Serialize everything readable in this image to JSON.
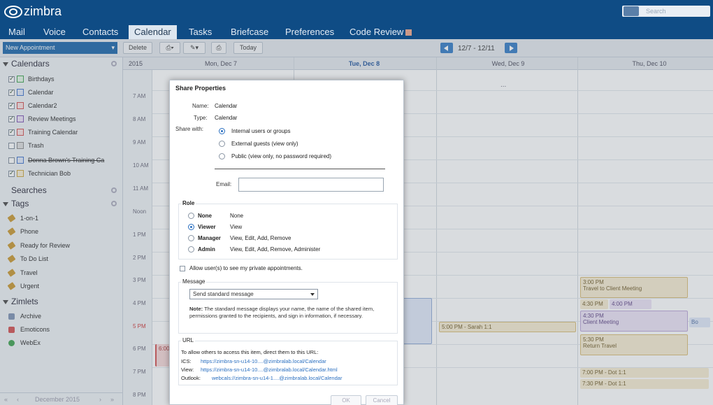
{
  "app": {
    "logo_text": "zimbra",
    "search_placeholder": "Search"
  },
  "tabs": [
    {
      "label": "Mail"
    },
    {
      "label": "Voice"
    },
    {
      "label": "Contacts"
    },
    {
      "label": "Calendar"
    },
    {
      "label": "Tasks"
    },
    {
      "label": "Briefcase"
    },
    {
      "label": "Preferences"
    },
    {
      "label": "Code Review"
    }
  ],
  "toolbar": {
    "new_appointment": "New Appointment",
    "delete": "Delete",
    "today": "Today",
    "date_range": "12/7 - 12/11"
  },
  "sidebar": {
    "calendars_header": "Calendars",
    "calendars": [
      {
        "label": "Birthdays",
        "checked": true,
        "color": "#3aa04a"
      },
      {
        "label": "Calendar",
        "checked": true,
        "color": "#3b6fc9"
      },
      {
        "label": "Calendar2",
        "checked": true,
        "color": "#d24b4b"
      },
      {
        "label": "Review Meetings",
        "checked": true,
        "color": "#7a4fb0"
      },
      {
        "label": "Training Calendar",
        "checked": true,
        "color": "#d24b4b"
      },
      {
        "label": "Trash",
        "checked": false,
        "color": "#8a8a8a"
      },
      {
        "label": "Donna Brown's Training Ca",
        "checked": false,
        "color": "#3b6fc9"
      },
      {
        "label": "Technician Bob",
        "checked": true,
        "color": "#c9a43b"
      }
    ],
    "searches_header": "Searches",
    "tags_header": "Tags",
    "tags": [
      {
        "label": "1-on-1"
      },
      {
        "label": "Phone"
      },
      {
        "label": "Ready for Review"
      },
      {
        "label": "To Do List"
      },
      {
        "label": "Travel"
      },
      {
        "label": "Urgent"
      }
    ],
    "zimlets_header": "Zimlets",
    "zimlets": [
      {
        "label": "Archive",
        "color": "#7a8fb0"
      },
      {
        "label": "Emoticons",
        "color": "#d24b4b"
      },
      {
        "label": "WebEx",
        "color": "#3aa04a"
      }
    ],
    "minical_label": "December 2015"
  },
  "calendar": {
    "year": "2015",
    "days": [
      "Mon, Dec 7",
      "Tue, Dec 8",
      "Wed, Dec 9",
      "Thu, Dec 10"
    ],
    "times": [
      "7 AM",
      "8 AM",
      "9 AM",
      "10 AM",
      "11 AM",
      "Noon",
      "1 PM",
      "2 PM",
      "3 PM",
      "4 PM",
      "5 PM",
      "6 PM",
      "7 PM",
      "8 PM"
    ],
    "more": "...",
    "events": {
      "mon_6pm": "6:00",
      "wed_sarah": "5:00 PM - Sarah 1:1",
      "thu_travel_time": "3:00 PM",
      "thu_travel_title": "Travel to Client Meeting",
      "thu_430_1": "4:30 PM",
      "thu_400": "4:00 PM",
      "thu_430_2": "4:30 PM",
      "thu_client": "Client Meeting",
      "thu_530": "5:30 PM",
      "thu_return": "Return Travel",
      "thu_7pm": "7:00 PM - Dot 1:1",
      "thu_730": "7:30 PM - Dot 1:1",
      "fri_label": "Bo"
    }
  },
  "dialog": {
    "title": "Share Properties",
    "name_label": "Name:",
    "name_value": "Calendar",
    "type_label": "Type:",
    "type_value": "Calendar",
    "share_with_label": "Share with:",
    "share_options": [
      "Internal users or groups",
      "External guests (view only)",
      "Public (view only, no password required)"
    ],
    "email_label": "Email:",
    "role_label": "Role",
    "roles": [
      {
        "name": "None",
        "desc": "None"
      },
      {
        "name": "Viewer",
        "desc": "View"
      },
      {
        "name": "Manager",
        "desc": "View, Edit, Add, Remove"
      },
      {
        "name": "Admin",
        "desc": "View, Edit, Add, Remove, Administer"
      }
    ],
    "private_label": "Allow user(s) to see my private appointments.",
    "message_label": "Message",
    "message_select": "Send standard message",
    "note_bold": "Note:",
    "note_text": " The standard message displays your name, the name of the shared item, permissions granted to the recipients, and sign in information, if necessary.",
    "url_label": "URL",
    "url_intro": "To allow others to access this item, direct them to this URL:",
    "ics_label": "ICS:",
    "ics_url": "https://zimbra-sn-u14-10....@zimbralab.local/Calendar",
    "view_label": "View:",
    "view_url": "https://zimbra-sn-u14-10....@zimbralab.local/Calendar.html",
    "outlook_label": "Outlook:",
    "outlook_url": "webcals://zimbra-sn-u14-1....@zimbralab.local/Calendar",
    "ok": "OK",
    "cancel": "Cancel"
  }
}
